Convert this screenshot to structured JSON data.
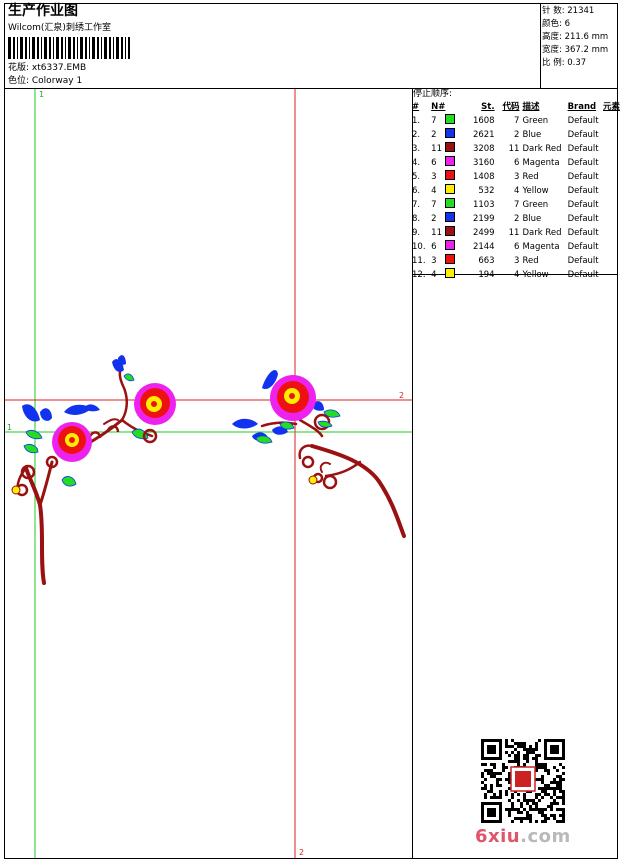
{
  "header": {
    "title": "生产作业图",
    "subtitle": "Wilcom(汇泉)刺绣工作室",
    "design_line": "花版: xt6337.EMB",
    "colorway_line": "色位: Colorway 1"
  },
  "stats": [
    "针 数: 21341",
    "颜色: 6",
    "高度: 211.6 mm",
    "宽度: 367.2 mm",
    "比 例: 0.37"
  ],
  "stop_sequence": {
    "label": "停止顺序:",
    "headers": [
      "#",
      "N#",
      "St.",
      "代码",
      "描述",
      "Brand",
      "元素"
    ],
    "rows": [
      {
        "idx": "1.",
        "needle": "7",
        "color": "#22dd22",
        "st": "1608",
        "code": "7",
        "desc": "Green",
        "brand": "Default"
      },
      {
        "idx": "2.",
        "needle": "2",
        "color": "#1133ee",
        "st": "2621",
        "code": "2",
        "desc": "Blue",
        "brand": "Default"
      },
      {
        "idx": "3.",
        "needle": "11",
        "color": "#991111",
        "st": "3208",
        "code": "11",
        "desc": "Dark Red",
        "brand": "Default"
      },
      {
        "idx": "4.",
        "needle": "6",
        "color": "#ee22ee",
        "st": "3160",
        "code": "6",
        "desc": "Magenta",
        "brand": "Default"
      },
      {
        "idx": "5.",
        "needle": "3",
        "color": "#ee1111",
        "st": "1408",
        "code": "3",
        "desc": "Red",
        "brand": "Default"
      },
      {
        "idx": "6.",
        "needle": "4",
        "color": "#ffee00",
        "st": "532",
        "code": "4",
        "desc": "Yellow",
        "brand": "Default"
      },
      {
        "idx": "7.",
        "needle": "7",
        "color": "#22dd22",
        "st": "1103",
        "code": "7",
        "desc": "Green",
        "brand": "Default"
      },
      {
        "idx": "8.",
        "needle": "2",
        "color": "#1133ee",
        "st": "2199",
        "code": "2",
        "desc": "Blue",
        "brand": "Default"
      },
      {
        "idx": "9.",
        "needle": "11",
        "color": "#991111",
        "st": "2499",
        "code": "11",
        "desc": "Dark Red",
        "brand": "Default"
      },
      {
        "idx": "10.",
        "needle": "6",
        "color": "#ee22ee",
        "st": "2144",
        "code": "6",
        "desc": "Magenta",
        "brand": "Default"
      },
      {
        "idx": "11.",
        "needle": "3",
        "color": "#ee1111",
        "st": "663",
        "code": "3",
        "desc": "Red",
        "brand": "Default"
      },
      {
        "idx": "12.",
        "needle": "4",
        "color": "#ffee00",
        "st": "194",
        "code": "4",
        "desc": "Yellow",
        "brand": "Default"
      }
    ]
  },
  "canvas": {
    "guide_labels": {
      "v1": "1",
      "v2": "2",
      "h1": "1",
      "h2": "2"
    },
    "guide_colors": {
      "green": "#22cc22",
      "red": "#dd2222"
    }
  },
  "watermark": {
    "main": "6xiu",
    "tail": ".com"
  }
}
